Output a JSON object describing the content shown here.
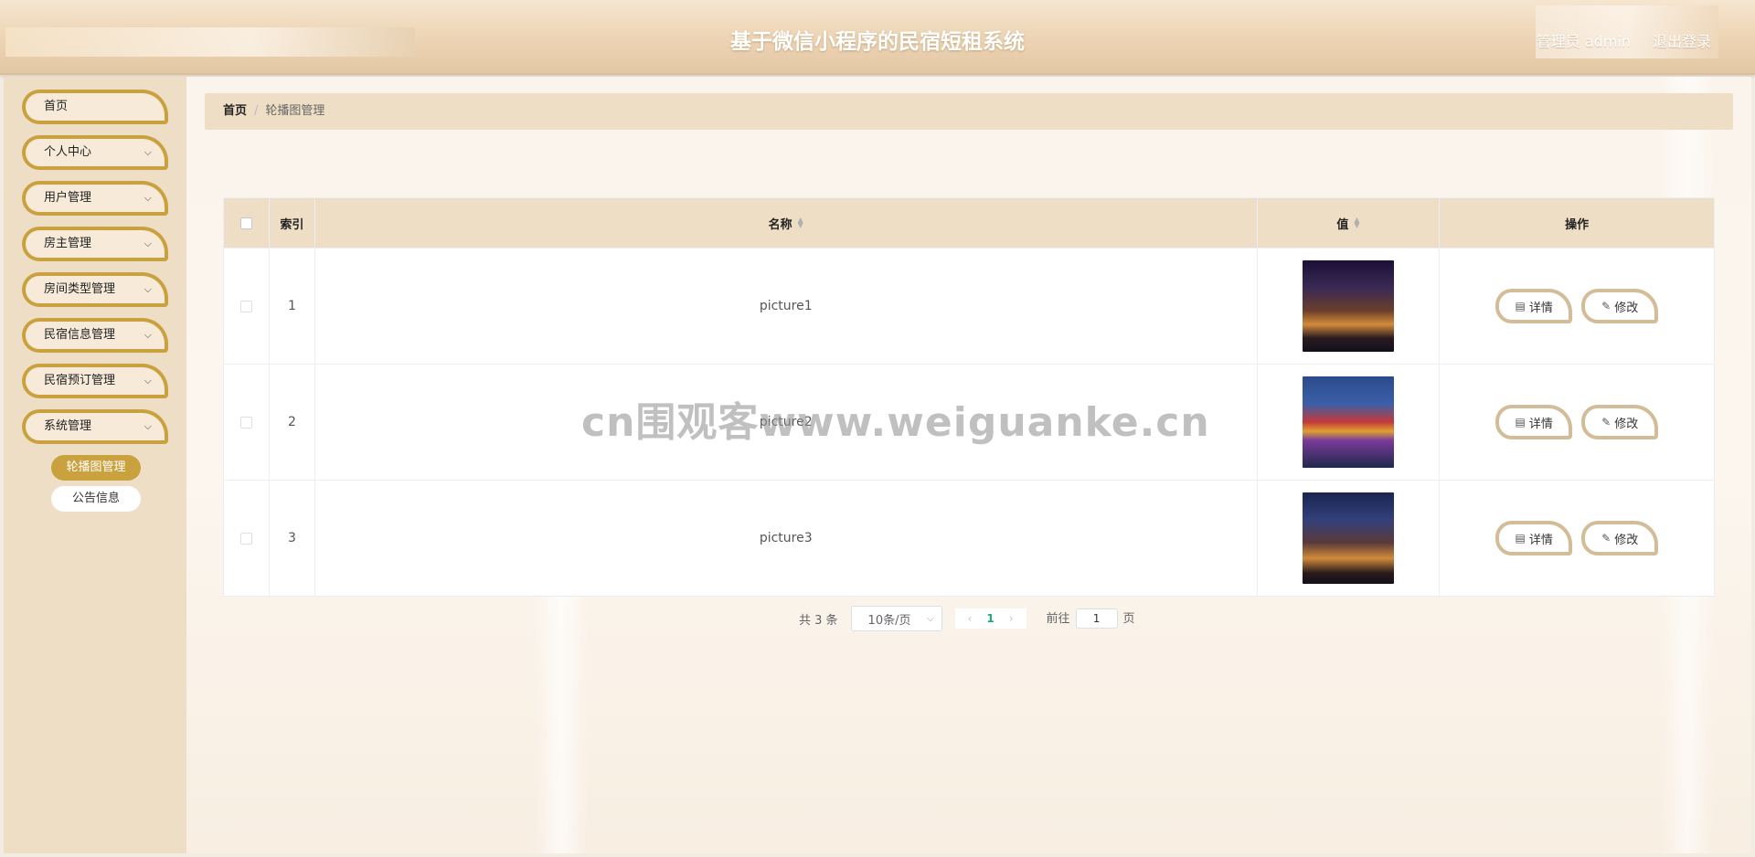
{
  "header": {
    "title": "基于微信小程序的民宿短租系统",
    "user": "管理员 admin",
    "logout": "退出登录"
  },
  "sidebar": {
    "items": [
      {
        "label": "首页",
        "has_arrow": false
      },
      {
        "label": "个人中心",
        "has_arrow": true
      },
      {
        "label": "用户管理",
        "has_arrow": true
      },
      {
        "label": "房主管理",
        "has_arrow": true
      },
      {
        "label": "房间类型管理",
        "has_arrow": true
      },
      {
        "label": "民宿信息管理",
        "has_arrow": true
      },
      {
        "label": "民宿预订管理",
        "has_arrow": true
      },
      {
        "label": "系统管理",
        "has_arrow": true
      }
    ],
    "sub_items": [
      {
        "label": "轮播图管理",
        "active": true
      },
      {
        "label": "公告信息",
        "active": false
      }
    ],
    "arrow": "⌵"
  },
  "breadcrumb": {
    "home": "首页",
    "separator": "/",
    "current": "轮播图管理"
  },
  "table": {
    "headers": {
      "index": "索引",
      "name": "名称",
      "value": "值",
      "actions": "操作"
    },
    "rows": [
      {
        "index": "1",
        "name": "picture1",
        "image": "city-night-skyline"
      },
      {
        "index": "2",
        "name": "picture2",
        "image": "colorful-houses-waterfront"
      },
      {
        "index": "3",
        "name": "picture3",
        "image": "canal-houses-night"
      }
    ],
    "detail_label": "详情",
    "edit_label": "修改"
  },
  "pagination": {
    "total": "共 3 条",
    "page_size": "10条/页",
    "current_page": "1",
    "goto_prefix": "前往",
    "goto_value": "1",
    "goto_suffix": "页"
  },
  "watermark": "cn围观客www.weiguanke.cn",
  "colors": {
    "accent": "#c9a23f",
    "header_bg": "#ecd3b3",
    "sidebar_bg": "#efdec6",
    "button_border": "#d2bd98",
    "page_active": "#1aa97b"
  }
}
